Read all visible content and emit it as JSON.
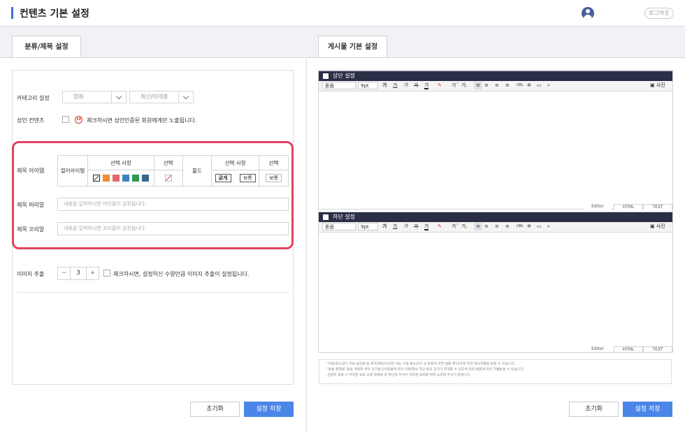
{
  "header": {
    "title": "컨텐츠 기본 설정",
    "logout_label": "로그아웃"
  },
  "tabs": {
    "left": "분류/제목 설정",
    "right": "게시물 기본 설정"
  },
  "left": {
    "category_label": "카테고리 설정",
    "category_select": "영화",
    "sort_select": "최신/미개봉",
    "adult_label": "성인 컨텐츠",
    "adult_badge": "19",
    "adult_desc": "체크하시면 성인인증된 회원에게만 노출됩니다.",
    "title_item_label": "제목 아이템",
    "color_item_label": "컬러아이템",
    "col_select1": "선택 사항",
    "col_choice1": "선택",
    "bold_label": "볼드",
    "col_select2": "선택 사항",
    "col_choice2": "선택",
    "bold_btn": "굵게",
    "normal_btn": "보통",
    "normal_btn2": "보통",
    "swatch_colors": [
      "#ffffff",
      "#f28c35",
      "#de6a6e",
      "#3c84be",
      "#2e9a52",
      "#3d6488"
    ],
    "prefix_label": "제목 머리말",
    "prefix_placeholder": "내용을 입력하시면 머리말이 설정됩니다.",
    "suffix_label": "제목 꼬리말",
    "suffix_placeholder": "내용을 입력하시면 꼬리말이 설정됩니다.",
    "image_label": "이미지 추출",
    "image_count": "3",
    "image_desc": "체크하시면, 설정하신 수량만큼 이미지 추출이 설정됩니다.",
    "reset_btn": "초기화",
    "save_btn": "설정 저장"
  },
  "right": {
    "top_editor_title": "상단 설정",
    "bottom_editor_title": "하단 설정",
    "font_select": "돋움",
    "size_select": "9pt",
    "photo_btn": "사진",
    "mode_editor": "Editor",
    "mode_html": "HTML",
    "mode_text": "TEXT",
    "notice": [
      "- '아동/청소년이 이용 음란물'을 제작/배포/소지한 자는 아동·청소년의 성 보호에 관한 법률 제11조에 따라 형사처벌을 받을 수 있습니다.",
      "- '불법 촬영물' 등을 게재할 경우 전기통신사업법에 따라 삭제/접속 차단 등의 조치가 취해질 수 있으며 관련 법률에 따라 처벌받을 수 있습니다.",
      "- 컨텐츠 등록 시 저작권 보호 요청 목록을 꼭 확인해 주셔서 저작권 보호를 위해 노력해 주시기 바랍니다."
    ],
    "reset_btn": "초기화",
    "save_btn": "설정 저장"
  }
}
